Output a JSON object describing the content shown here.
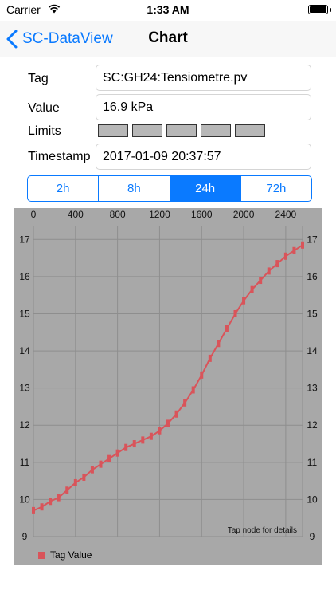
{
  "status": {
    "carrier": "Carrier",
    "time": "1:33 AM"
  },
  "nav": {
    "back_label": "SC-DataView",
    "title": "Chart"
  },
  "form": {
    "tag_label": "Tag",
    "tag_value": "SC:GH24:Tensiometre.pv",
    "value_label": "Value",
    "value_value": "16.9 kPa",
    "limits_label": "Limits",
    "timestamp_label": "Timestamp",
    "timestamp_value": "2017-01-09 20:37:57"
  },
  "segments": {
    "items": [
      "2h",
      "8h",
      "24h",
      "72h"
    ],
    "selected": "24h"
  },
  "colors": {
    "accent": "#0a7aff",
    "series": "#d9545a",
    "chart_bg": "#a8a8a8",
    "limit_box": "#b7b7b7"
  },
  "chart_data": {
    "type": "line",
    "x_ticks": [
      "0",
      "400",
      "800",
      "1200",
      "1600",
      "2000",
      "2400"
    ],
    "y_ticks": [
      "9",
      "10",
      "11",
      "12",
      "13",
      "14",
      "15",
      "16",
      "17"
    ],
    "xlim": [
      0,
      2560
    ],
    "ylim": [
      9,
      17.35
    ],
    "grid": true,
    "legend_position": "bottom-left",
    "annotation": "Tap node for details",
    "series": [
      {
        "name": "Tag Value",
        "points": [
          [
            0,
            9.7
          ],
          [
            80,
            9.8
          ],
          [
            160,
            9.95
          ],
          [
            240,
            10.05
          ],
          [
            320,
            10.25
          ],
          [
            400,
            10.45
          ],
          [
            480,
            10.6
          ],
          [
            560,
            10.8
          ],
          [
            640,
            10.95
          ],
          [
            720,
            11.1
          ],
          [
            800,
            11.25
          ],
          [
            880,
            11.4
          ],
          [
            960,
            11.5
          ],
          [
            1040,
            11.6
          ],
          [
            1120,
            11.7
          ],
          [
            1200,
            11.85
          ],
          [
            1280,
            12.05
          ],
          [
            1360,
            12.3
          ],
          [
            1440,
            12.6
          ],
          [
            1520,
            12.95
          ],
          [
            1600,
            13.35
          ],
          [
            1680,
            13.8
          ],
          [
            1760,
            14.2
          ],
          [
            1840,
            14.6
          ],
          [
            1920,
            15.0
          ],
          [
            2000,
            15.35
          ],
          [
            2080,
            15.65
          ],
          [
            2160,
            15.9
          ],
          [
            2240,
            16.15
          ],
          [
            2320,
            16.35
          ],
          [
            2400,
            16.55
          ],
          [
            2480,
            16.7
          ],
          [
            2560,
            16.85
          ]
        ]
      }
    ]
  }
}
